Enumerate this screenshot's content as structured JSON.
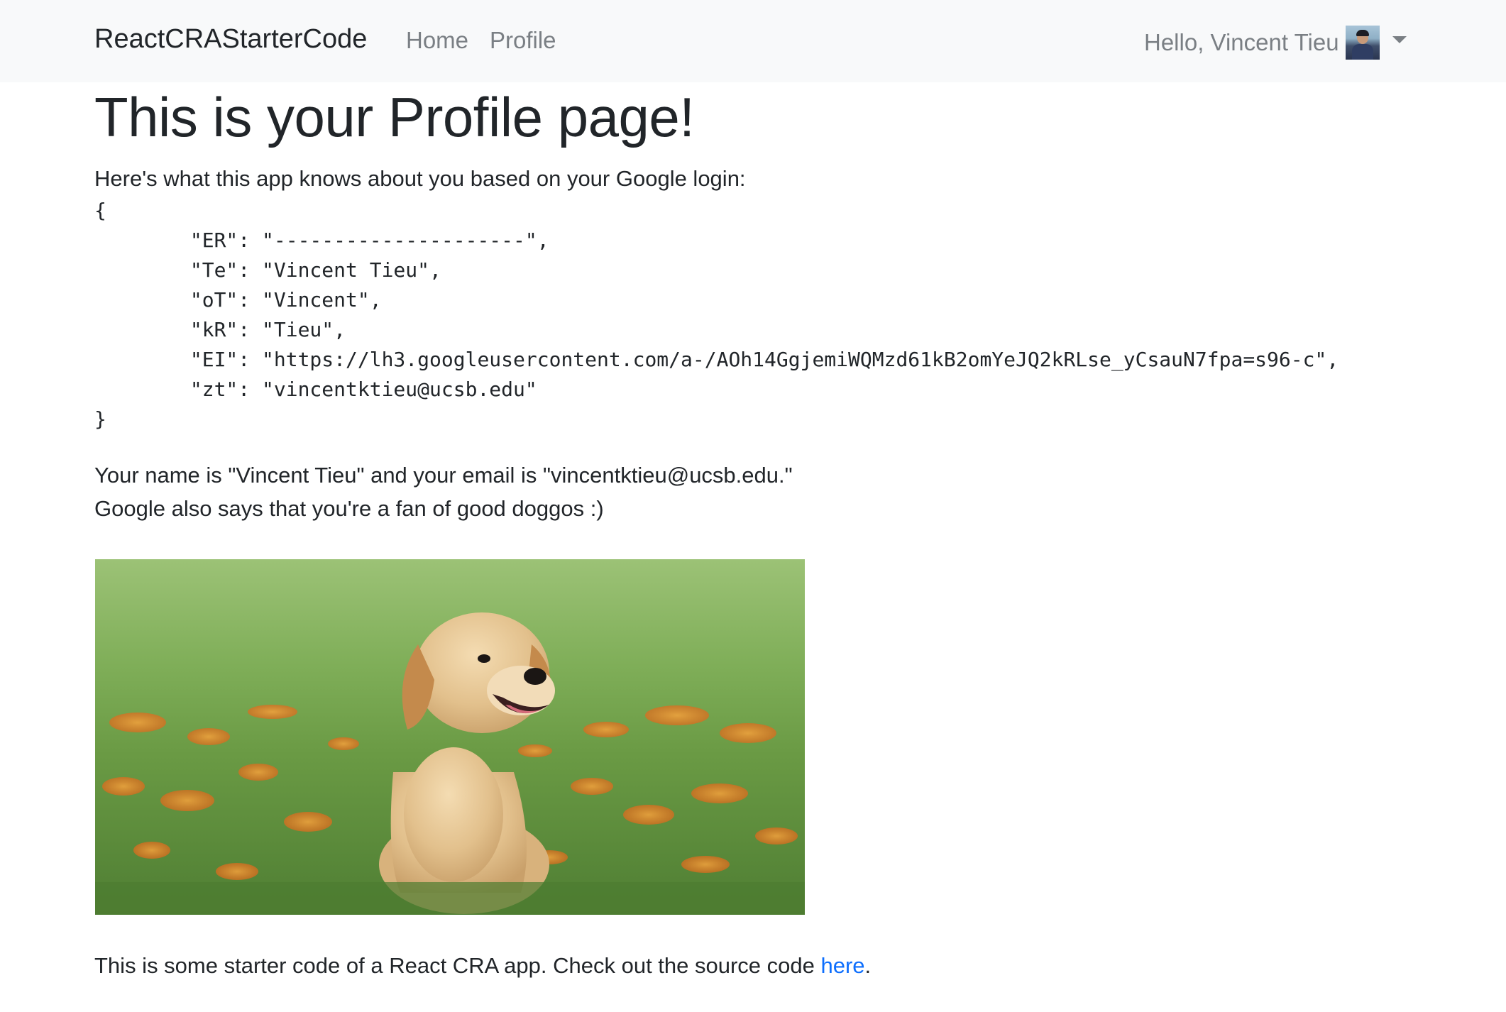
{
  "navbar": {
    "brand": "ReactCRAStarterCode",
    "links": [
      {
        "label": "Home"
      },
      {
        "label": "Profile"
      }
    ],
    "user": {
      "greeting": "Hello, Vincent Tieu"
    }
  },
  "main": {
    "title": "This is your Profile page!",
    "intro": "Here's what this app knows about you based on your Google login:",
    "json_lines": [
      "{",
      "        \"ER\": \"---------------------\",",
      "        \"Te\": \"Vincent Tieu\",",
      "        \"oT\": \"Vincent\",",
      "        \"kR\": \"Tieu\",",
      "        \"EI\": \"https://lh3.googleusercontent.com/a-/AOh14GgjemiWQMzd61kB2omYeJQ2kRLse_yCsauN7fpa=s96-c\",",
      "        \"zt\": \"vincentktieu@ucsb.edu\"",
      "}"
    ],
    "summary_line_1": "Your name is \"Vincent Tieu\" and your email is \"vincentktieu@ucsb.edu.\"",
    "summary_line_2": "Google also says that you're a fan of good doggos :)",
    "footer_prefix": "This is some starter code of a React CRA app. Check out the source code ",
    "footer_link": "here",
    "footer_suffix": "."
  },
  "colors": {
    "navbar_bg": "#f8f9fa",
    "nav_link": "#7a7f84",
    "text": "#212529",
    "link": "#0d6efd"
  }
}
